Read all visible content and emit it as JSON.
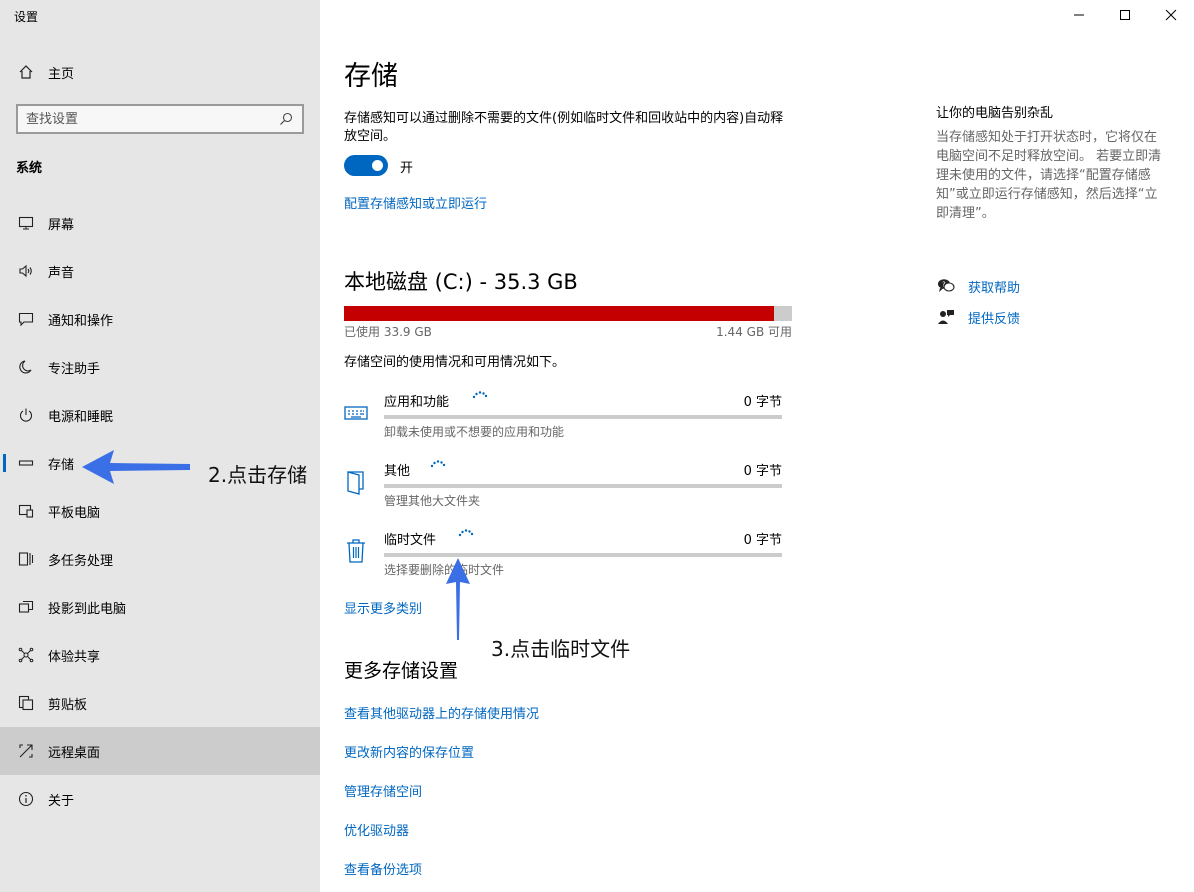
{
  "window": {
    "title": "设置"
  },
  "sidebar": {
    "home_label": "主页",
    "search_placeholder": "查找设置",
    "section_title": "系统",
    "items": [
      {
        "label": "屏幕",
        "icon": "monitor-icon"
      },
      {
        "label": "声音",
        "icon": "speaker-icon"
      },
      {
        "label": "通知和操作",
        "icon": "notification-icon"
      },
      {
        "label": "专注助手",
        "icon": "moon-icon"
      },
      {
        "label": "电源和睡眠",
        "icon": "power-icon"
      },
      {
        "label": "存储",
        "icon": "storage-icon",
        "selected": true
      },
      {
        "label": "平板电脑",
        "icon": "tablet-icon"
      },
      {
        "label": "多任务处理",
        "icon": "multitask-icon"
      },
      {
        "label": "投影到此电脑",
        "icon": "project-icon"
      },
      {
        "label": "体验共享",
        "icon": "share-icon"
      },
      {
        "label": "剪贴板",
        "icon": "clipboard-icon"
      },
      {
        "label": "远程桌面",
        "icon": "remote-desktop-icon",
        "highlighted": true
      },
      {
        "label": "关于",
        "icon": "info-icon"
      }
    ]
  },
  "main": {
    "title": "存储",
    "sense_description": "存储感知可以通过删除不需要的文件(例如临时文件和回收站中的内容)自动释放空间。",
    "toggle_label": "开",
    "toggle_on": true,
    "configure_link": "配置存储感知或立即运行",
    "disk_title": "本地磁盘 (C:) - 35.3 GB",
    "used_label": "已使用 33.9 GB",
    "free_label": "1.44 GB 可用",
    "used_fraction": 0.96,
    "usage_note": "存储空间的使用情况和可用情况如下。",
    "categories": [
      {
        "name": "应用和功能",
        "size": "0 字节",
        "desc": "卸载未使用或不想要的应用和功能",
        "icon": "keyboard-icon"
      },
      {
        "name": "其他",
        "size": "0 字节",
        "desc": "管理其他大文件夹",
        "icon": "folder-icon"
      },
      {
        "name": "临时文件",
        "size": "0 字节",
        "desc": "选择要删除的临时文件",
        "icon": "trash-icon"
      }
    ],
    "more_categories_link": "显示更多类别",
    "more_settings_title": "更多存储设置",
    "more_links": [
      "查看其他驱动器上的存储使用情况",
      "更改新内容的保存位置",
      "管理存储空间",
      "优化驱动器",
      "查看备份选项"
    ]
  },
  "aside": {
    "title": "让你的电脑告别杂乱",
    "description": "当存储感知处于打开状态时，它将仅在电脑空间不足时释放空间。 若要立即清理未使用的文件，请选择“配置存储感知”或立即运行存储感知，然后选择“立即清理”。",
    "help_link": "获取帮助",
    "feedback_link": "提供反馈"
  },
  "annotations": {
    "step2": "2.点击存储",
    "step3": "3.点击临时文件",
    "arrow_color": "#3b6fe6"
  },
  "colors": {
    "accent": "#0067c0",
    "disk_used": "#c40000",
    "sidebar_bg": "#e6e6e6"
  }
}
